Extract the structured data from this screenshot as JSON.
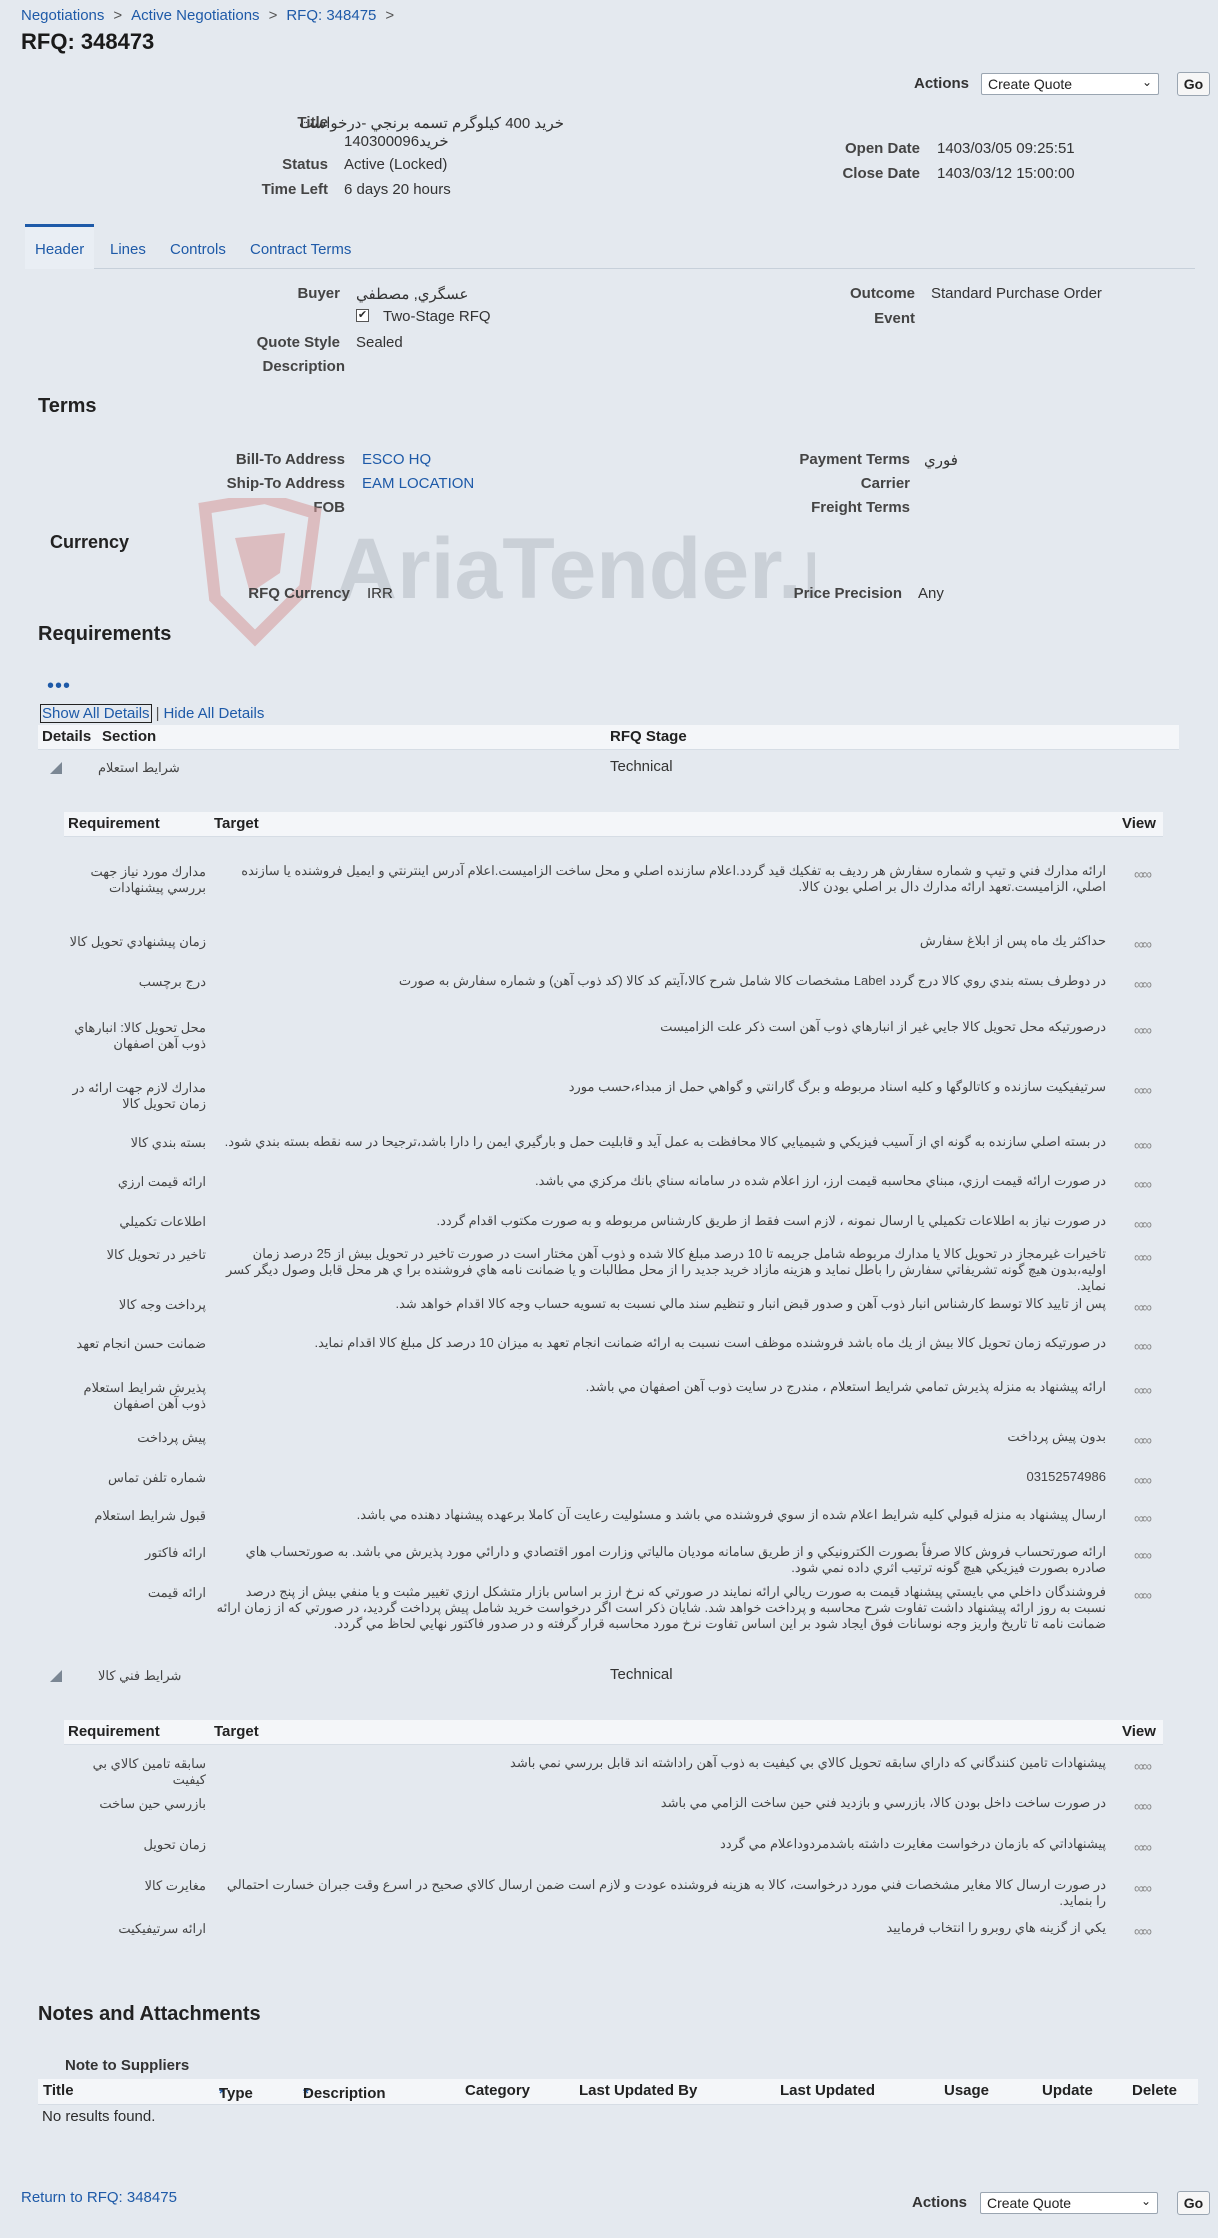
{
  "breadcrumbs": [
    "Negotiations",
    "Active Negotiations",
    "RFQ: 348475"
  ],
  "page_title": "RFQ: 348473",
  "actions": {
    "label": "Actions",
    "selected": "Create Quote",
    "go": "Go"
  },
  "summary": {
    "title_label": "Title",
    "title_line1": "خريد 400 كيلوگرم تسمه برنجي -درخواست",
    "title_line2": "140300096خريد",
    "status_label": "Status",
    "status_value": "Active (Locked)",
    "time_left_label": "Time Left",
    "time_left_value": "6 days 20 hours",
    "open_date_label": "Open Date",
    "open_date_value": "1403/03/05 09:25:51",
    "close_date_label": "Close Date",
    "close_date_value": "1403/03/12 15:00:00"
  },
  "tabs": [
    "Header",
    "Lines",
    "Controls",
    "Contract Terms"
  ],
  "header": {
    "buyer_label": "Buyer",
    "buyer_value": "عسگري, مصطفي",
    "two_stage_label": "Two-Stage RFQ",
    "two_stage_checked": true,
    "quote_style_label": "Quote Style",
    "quote_style_value": "Sealed",
    "description_label": "Description",
    "outcome_label": "Outcome",
    "outcome_value": "Standard Purchase Order",
    "event_label": "Event"
  },
  "terms": {
    "title": "Terms",
    "bill_to_label": "Bill-To Address",
    "bill_to_value": "ESCO HQ",
    "ship_to_label": "Ship-To Address",
    "ship_to_value": "EAM LOCATION",
    "fob_label": "FOB",
    "payment_terms_label": "Payment Terms",
    "payment_terms_value": "فوري",
    "carrier_label": "Carrier",
    "freight_terms_label": "Freight Terms"
  },
  "currency": {
    "title": "Currency",
    "rfq_currency_label": "RFQ Currency",
    "rfq_currency_value": "IRR",
    "price_precision_label": "Price Precision",
    "price_precision_value": "Any"
  },
  "watermark_text": "AriaTender.neT",
  "requirements": {
    "title": "Requirements",
    "more_icon": "more-dots-icon",
    "show_all": "Show All Details",
    "hide_all": "Hide All Details",
    "col_details": "Details",
    "col_section": "Section",
    "col_stage": "RFQ Stage",
    "col_requirement": "Requirement",
    "col_target": "Target",
    "col_view": "View",
    "sections": [
      {
        "name": "شرايط استعلام",
        "stage": "Technical",
        "rows": [
          {
            "req": "مدارك مورد نياز جهت بررسي پيشنهادات",
            "target": "ارائه مدارك فني و تيپ و شماره سفارش هر رديف به تفكيك قيد گردد.اعلام سازنده اصلي و محل ساخت الزاميست.اعلام آدرس اينترنتي و ايميل فروشنده يا سازنده اصلي، الزاميست.تعهد ارائه مدارك دال بر اصلي بودن كالا."
          },
          {
            "req": "زمان پيشنهادي تحويل كالا",
            "target": "حداكثر يك ماه پس از ابلاغ سفارش"
          },
          {
            "req": "درج برچسب",
            "target": "در دوطرف بسته بندي روي كالا درج گردد Label مشخصات كالا شامل شرح كالا،آيتم كد كالا (كد ذوب آهن) و شماره سفارش به صورت"
          },
          {
            "req": "محل تحويل كالا: انبارهاي ذوب آهن اصفهان",
            "target": "درصورتيكه محل تحويل كالا جايي غير از انبارهاي ذوب آهن است ذكر علت الزاميست"
          },
          {
            "req": "مدارك لازم جهت ارائه در زمان تحويل كالا",
            "target": "سرتيفيكيت سازنده و كاتالوگها و كليه اسناد مربوطه و برگ گارانتي و گواهي حمل از مبداء،حسب مورد"
          },
          {
            "req": "بسته بندي كالا",
            "target": "در بسته اصلي سازنده به گونه اي از آسيب فيزيكي و شيميايي كالا محافظت به عمل آيد و قابليت حمل و بارگيري ايمن را دارا باشد،ترجيحا در سه نقطه بسته بندي شود."
          },
          {
            "req": "ارائه قيمت ارزي",
            "target": "در صورت ارائه قيمت ارزي، مبناي محاسبه قيمت ارز، ارز اعلام شده در سامانه سناي بانك مركزي مي باشد."
          },
          {
            "req": "اطلاعات تكميلي",
            "target": "در صورت نياز به اطلاعات تكميلي يا ارسال نمونه ، لازم است فقط از طريق كارشناس مربوطه و به صورت مكتوب اقدام گردد."
          },
          {
            "req": "تاخير در تحويل كالا",
            "target": "تاخيرات غيرمجاز در تحويل كالا يا مدارك مربوطه شامل جريمه تا 10 درصد مبلغ كالا شده و ذوب آهن مختار است در صورت تاخير در تحويل بيش از 25 درصد زمان اوليه،بدون هيچ گونه تشريفاتي سفارش را باطل نمايد و هزينه مازاد خريد جديد را از محل مطالبات و يا ضمانت نامه هاي فروشنده برا ي هر محل قابل وصول ديگر كسر نمايد."
          },
          {
            "req": "پرداخت وجه كالا",
            "target": "پس از تاييد كالا توسط كارشناس انبار ذوب آهن و صدور قبض انبار و تنظيم سند مالي نسبت به تسويه حساب وجه كالا اقدام خواهد شد."
          },
          {
            "req": "ضمانت حسن انجام تعهد",
            "target": "در صورتيكه زمان تحويل كالا بيش از يك ماه باشد فروشنده موظف است نسبت به ارائه ضمانت انجام تعهد به ميزان 10 درصد كل مبلغ كالا اقدام نمايد."
          },
          {
            "req": "پذيرش شرايط استعلام ذوب آهن اصفهان",
            "target": "ارائه پيشنهاد به منزله پذيرش تمامي شرايط استعلام ، مندرج در سايت ذوب آهن اصفهان مي باشد."
          },
          {
            "req": "پيش پرداخت",
            "target": "بدون پيش پرداخت"
          },
          {
            "req": "شماره تلفن تماس",
            "target": "03152574986"
          },
          {
            "req": "قبول شرايط استعلام",
            "target": "ارسال پيشنهاد به منزله قبولي كليه شرايط اعلام شده از سوي فروشنده مي باشد و مسئوليت رعايت آن كاملا برعهده پيشنهاد دهنده مي باشد."
          },
          {
            "req": "ارائه فاكتور",
            "target": "ارائه صورتحساب فروش كالا صرفاً بصورت الكترونيكي و از طريق سامانه موديان مالياتي وزارت امور اقتصادي و دارائي مورد پذيرش مي باشد. به صورتحساب هاي صادره بصورت فيزيكي هيچ گونه ترتيب اثري داده نمي شود."
          },
          {
            "req": "ارائه قيمت",
            "target": "فروشندگان داخلي مي بايستي پيشنهاد قيمت به صورت ريالي ارائه نمايند در صورتي كه نرخ ارز بر اساس بازار متشكل ارزي تغيير مثبت و يا منفي بيش از پنج درصد نسبت به روز ارائه پيشنهاد داشت تفاوت شرح محاسبه و پرداخت خواهد شد. شايان ذكر است اگر درخواست خريد شامل پيش پرداخت گرديد، در صورتي كه از زمان ارائه ضمانت نامه تا تاريخ واريز وجه نوسانات فوق ايجاد شود بر اين اساس تفاوت نرخ مورد محاسبه قرار گرفته و در صدور فاكتور نهايي لحاظ مي گردد."
          }
        ]
      },
      {
        "name": "شرايط فني كالا",
        "stage": "Technical",
        "rows": [
          {
            "req": "سابقه تامين كالاي بي كيفيت",
            "target": "پيشنهادات تامين كنندگاني كه داراي سابقه تحويل كالاي بي كيفيت به ذوب آهن راداشته اند قابل بررسي نمي باشد"
          },
          {
            "req": "بازرسي حين ساخت",
            "target": "در صورت ساخت داخل بودن كالا، بازرسي و بازديد فني حين ساخت الزامي مي باشد"
          },
          {
            "req": "زمان تحويل",
            "target": "پيشنهاداتي كه بازمان درخواست مغايرت داشته باشدمردوداعلام مي گردد"
          },
          {
            "req": "مغايرت كالا",
            "target": "در صورت ارسال كالا مغاير مشخصات فني مورد درخواست، كالا به هزينه فروشنده عودت و لازم است ضمن ارسال كالاي صحيح در اسرع وقت جبران خسارت احتمالي را بنمايد."
          },
          {
            "req": "ارائه سرتيفيكيت",
            "target": "يكي از گزينه هاي روبرو را انتخاب فرماييد"
          }
        ]
      }
    ]
  },
  "notes": {
    "title": "Notes and Attachments",
    "note_to_suppliers": "Note to Suppliers",
    "columns": [
      "Title",
      "Type",
      "Description",
      "Category",
      "Last Updated By",
      "Last Updated",
      "Usage",
      "Update",
      "Delete"
    ],
    "empty": "No results found."
  },
  "footer": {
    "return_link": "Return to RFQ: 348475"
  }
}
